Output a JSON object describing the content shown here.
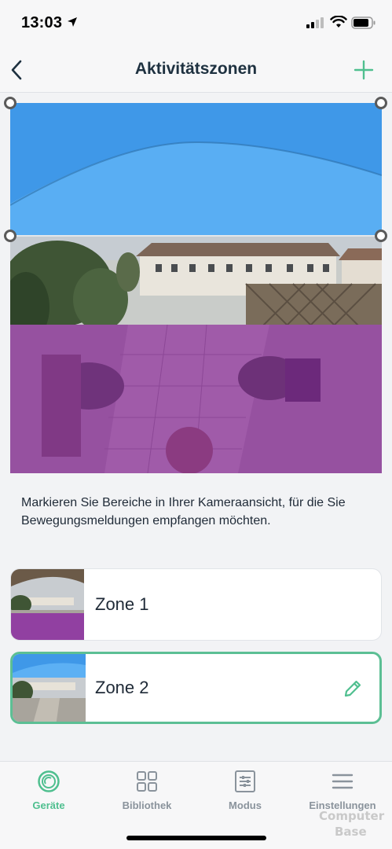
{
  "status_bar": {
    "time": "13:03",
    "location_icon": "location-arrow-icon",
    "signal_icon": "cellular-signal-icon",
    "wifi_icon": "wifi-icon",
    "battery_icon": "battery-icon"
  },
  "nav": {
    "title": "Aktivitätszonen",
    "back_icon": "chevron-left-icon",
    "add_icon": "plus-icon"
  },
  "camera": {
    "zone1_color": "#3f98e8",
    "zone2_color": "#8a1fa3"
  },
  "description": "Markieren Sie Bereiche in Ihrer Kameraansicht, für die Sie Bewegungsmeldungen empfangen möchten.",
  "zones": [
    {
      "name": "Zone 1",
      "selected": false
    },
    {
      "name": "Zone 2",
      "selected": true,
      "edit_icon": "pencil-icon"
    }
  ],
  "tabs": [
    {
      "label": "Geräte",
      "icon": "camera-ring-icon",
      "active": true
    },
    {
      "label": "Bibliothek",
      "icon": "grid-icon",
      "active": false
    },
    {
      "label": "Modus",
      "icon": "sliders-icon",
      "active": false
    },
    {
      "label": "Einstellungen",
      "icon": "menu-icon",
      "active": false
    }
  ],
  "watermark": {
    "line1": "Computer",
    "line2": "Base"
  },
  "colors": {
    "accent": "#4fbf8f",
    "title": "#1e3140",
    "inactive_tab": "#8a939c"
  }
}
